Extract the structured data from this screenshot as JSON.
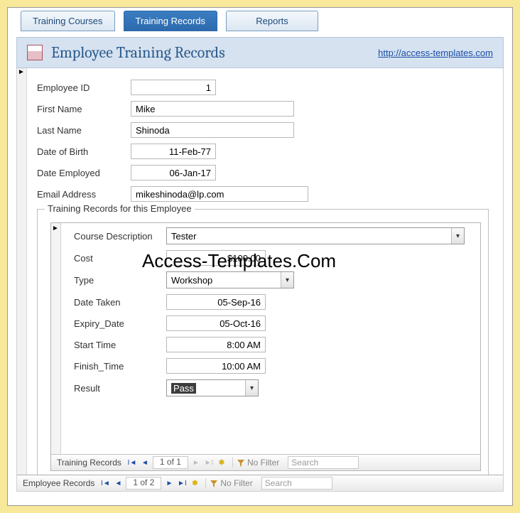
{
  "tabs": {
    "courses": "Training Courses",
    "records": "Training Records",
    "reports": "Reports"
  },
  "header": {
    "title": "Employee Training Records",
    "link": "http://access-templates.com"
  },
  "employee": {
    "labels": {
      "id": "Employee ID",
      "first": "First Name",
      "last": "Last Name",
      "dob": "Date of Birth",
      "employed": "Date Employed",
      "email": "Email Address"
    },
    "values": {
      "id": "1",
      "first": "Mike",
      "last": "Shinoda",
      "dob": "11-Feb-77",
      "employed": "06-Jan-17",
      "email": "mikeshinoda@lp.com"
    }
  },
  "sub": {
    "legend": "Training Records for this Employee",
    "labels": {
      "course": "Course Description",
      "cost": "Cost",
      "type": "Type",
      "taken": "Date Taken",
      "expiry": "Expiry_Date",
      "start": "Start Time",
      "finish": "Finish_Time",
      "result": "Result"
    },
    "values": {
      "course": "Tester",
      "cost": "$100.00",
      "type": "Workshop",
      "taken": "05-Sep-16",
      "expiry": "05-Oct-16",
      "start": "8:00 AM",
      "finish": "10:00 AM",
      "result": "Pass"
    }
  },
  "nav": {
    "innerName": "Training Records",
    "innerPos": "1 of 1",
    "outerName": "Employee Records",
    "outerPos": "1 of 2",
    "noFilter": "No Filter",
    "searchPlaceholder": "Search"
  },
  "watermark": "Access-Templates.Com"
}
